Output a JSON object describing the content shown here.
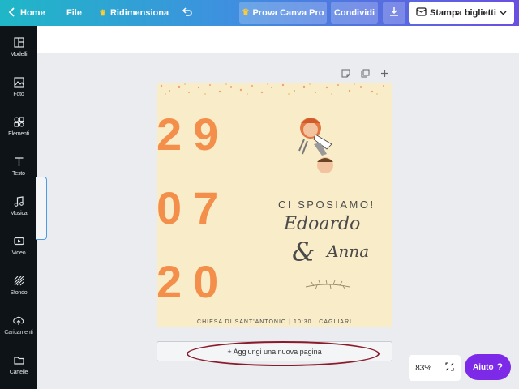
{
  "topbar": {
    "home": "Home",
    "file": "File",
    "resize": "Ridimensiona",
    "pro": "Prova Canva Pro",
    "share": "Condividi",
    "print": "Stampa biglietti"
  },
  "sidebar": {
    "items": [
      {
        "label": "Modelli",
        "icon": "template-icon"
      },
      {
        "label": "Foto",
        "icon": "photo-icon"
      },
      {
        "label": "Elementi",
        "icon": "elements-icon"
      },
      {
        "label": "Testo",
        "icon": "text-icon"
      },
      {
        "label": "Musica",
        "icon": "music-icon"
      },
      {
        "label": "Video",
        "icon": "video-icon"
      },
      {
        "label": "Sfondo",
        "icon": "background-icon"
      },
      {
        "label": "Caricamenti",
        "icon": "upload-icon"
      },
      {
        "label": "Cartelle",
        "icon": "folder-icon"
      }
    ]
  },
  "design": {
    "date_lines": [
      "29",
      "07",
      "20"
    ],
    "heading": "CI SPOSIAMO!",
    "name1": "Edoardo",
    "amp": "&",
    "name2": "Anna",
    "footer": "CHIESA DI SANT'ANTONIO | 10:30 | CAGLIARI",
    "background_color": "#f9ecc9",
    "number_color": "#f38f4a"
  },
  "add_page": "+ Aggiungi una nuova pagina",
  "zoom": "83%",
  "help": "Aiuto",
  "help_symbol": "?",
  "colors": {
    "sidebar": "#0e1318",
    "help_button": "#7d2ae8",
    "annotation": "#8b1a2a"
  }
}
